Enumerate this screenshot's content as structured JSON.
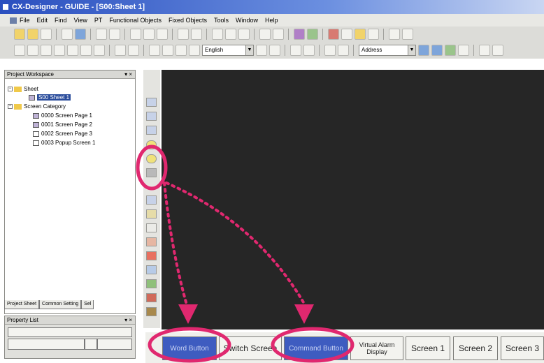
{
  "window": {
    "title": "CX-Designer - GUIDE - [S00:Sheet 1]"
  },
  "menu": [
    "File",
    "Edit",
    "Find",
    "View",
    "PT",
    "Functional Objects",
    "Fixed Objects",
    "Tools",
    "Window",
    "Help"
  ],
  "toolbar2": {
    "language_combo": "English",
    "address_combo": "Address"
  },
  "workspace": {
    "title": "Project Workspace",
    "tree": {
      "sheet_folder": "Sheet",
      "sheet_item": "S00 Sheet 1",
      "screen_folder": "Screen Category",
      "pages": [
        "0000 Screen Page 1",
        "0001 Screen Page 2",
        "0002 Screen Page 3",
        "0003 Popup Screen 1"
      ]
    },
    "tabs": [
      "Project Sheet",
      "Common Setting",
      "Sel"
    ]
  },
  "property_list": {
    "title": "Property List"
  },
  "object_bar": {
    "items": [
      {
        "label": "Word Button",
        "highlighted": true
      },
      {
        "label": "Switch Screen",
        "highlighted": false
      },
      {
        "label": "Command Button",
        "highlighted": true
      },
      {
        "label": "Virtual Alarm Display",
        "highlighted": false
      },
      {
        "label": "Screen 1",
        "highlighted": false
      },
      {
        "label": "Screen 2",
        "highlighted": false
      },
      {
        "label": "Screen 3",
        "highlighted": false
      }
    ]
  },
  "annotation_colors": {
    "circle": "#e0286f",
    "arrow": "#e0286f"
  }
}
